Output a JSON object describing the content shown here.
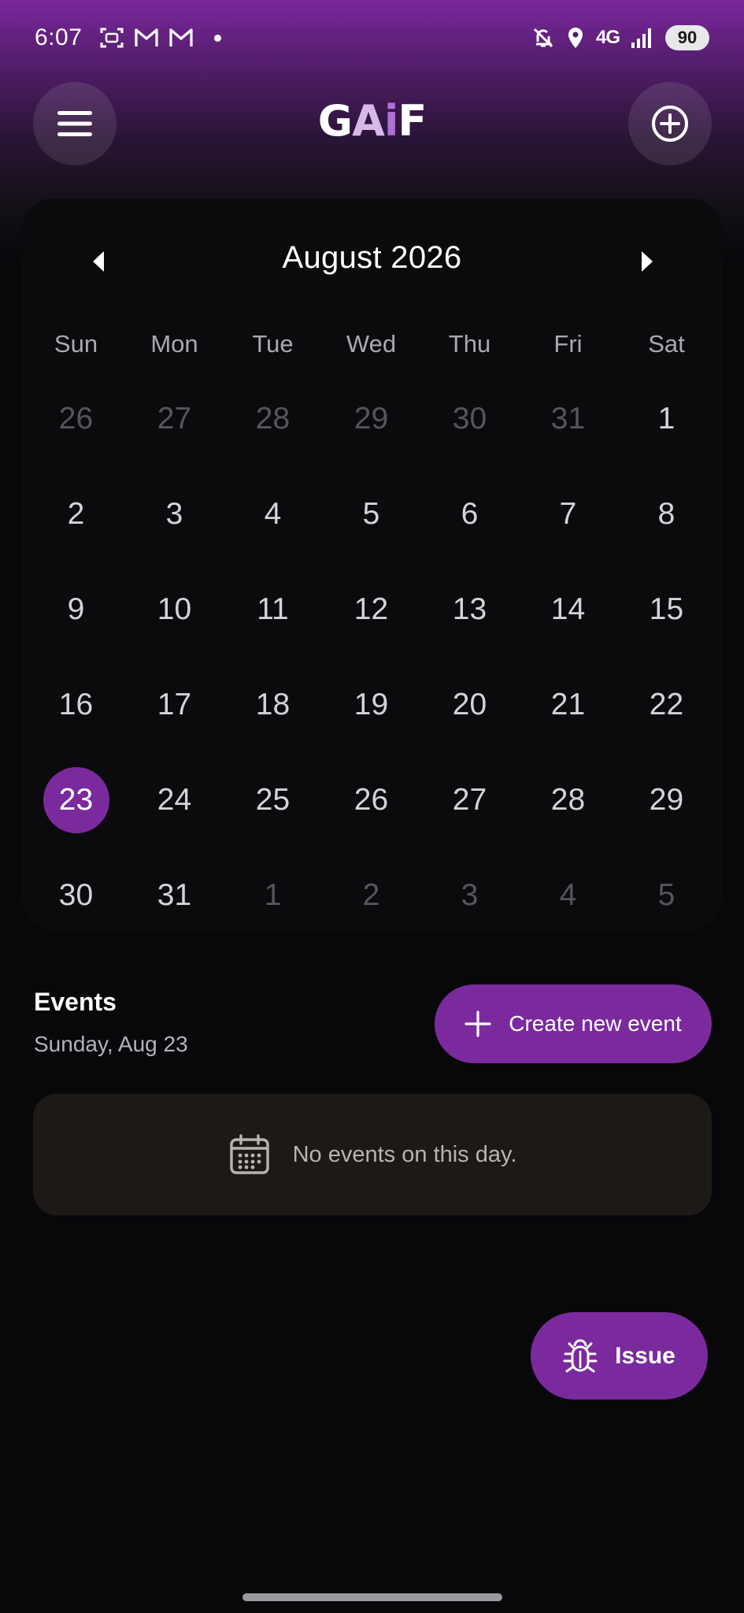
{
  "status_bar": {
    "time": "6:07",
    "network": "4G",
    "battery": "90"
  },
  "app_bar": {
    "logo": {
      "g": "G",
      "a": "A",
      "i": "i",
      "f": "F"
    },
    "menu_icon": "hamburger-menu-icon",
    "add_icon": "add-circle-icon"
  },
  "calendar": {
    "month_title": "August 2026",
    "weekdays": [
      "Sun",
      "Mon",
      "Tue",
      "Wed",
      "Thu",
      "Fri",
      "Sat"
    ],
    "days": [
      {
        "n": "26",
        "muted": true
      },
      {
        "n": "27",
        "muted": true
      },
      {
        "n": "28",
        "muted": true
      },
      {
        "n": "29",
        "muted": true
      },
      {
        "n": "30",
        "muted": true
      },
      {
        "n": "31",
        "muted": true
      },
      {
        "n": "1",
        "muted": false
      },
      {
        "n": "2",
        "muted": false
      },
      {
        "n": "3",
        "muted": false
      },
      {
        "n": "4",
        "muted": false
      },
      {
        "n": "5",
        "muted": false
      },
      {
        "n": "6",
        "muted": false
      },
      {
        "n": "7",
        "muted": false
      },
      {
        "n": "8",
        "muted": false
      },
      {
        "n": "9",
        "muted": false
      },
      {
        "n": "10",
        "muted": false
      },
      {
        "n": "11",
        "muted": false
      },
      {
        "n": "12",
        "muted": false
      },
      {
        "n": "13",
        "muted": false
      },
      {
        "n": "14",
        "muted": false
      },
      {
        "n": "15",
        "muted": false
      },
      {
        "n": "16",
        "muted": false
      },
      {
        "n": "17",
        "muted": false
      },
      {
        "n": "18",
        "muted": false
      },
      {
        "n": "19",
        "muted": false
      },
      {
        "n": "20",
        "muted": false
      },
      {
        "n": "21",
        "muted": false
      },
      {
        "n": "22",
        "muted": false
      },
      {
        "n": "23",
        "muted": false,
        "selected": true
      },
      {
        "n": "24",
        "muted": false
      },
      {
        "n": "25",
        "muted": false
      },
      {
        "n": "26",
        "muted": false
      },
      {
        "n": "27",
        "muted": false
      },
      {
        "n": "28",
        "muted": false
      },
      {
        "n": "29",
        "muted": false
      },
      {
        "n": "30",
        "muted": false
      },
      {
        "n": "31",
        "muted": false
      },
      {
        "n": "1",
        "muted": true
      },
      {
        "n": "2",
        "muted": true
      },
      {
        "n": "3",
        "muted": true
      },
      {
        "n": "4",
        "muted": true
      },
      {
        "n": "5",
        "muted": true
      }
    ]
  },
  "events": {
    "title": "Events",
    "date": "Sunday, Aug 23",
    "create_label": "Create new event",
    "empty_text": "No events on this day."
  },
  "fab": {
    "label": "Issue"
  },
  "colors": {
    "accent": "#7b2a9e",
    "background": "#08080b",
    "empty_card": "#1c1917"
  }
}
